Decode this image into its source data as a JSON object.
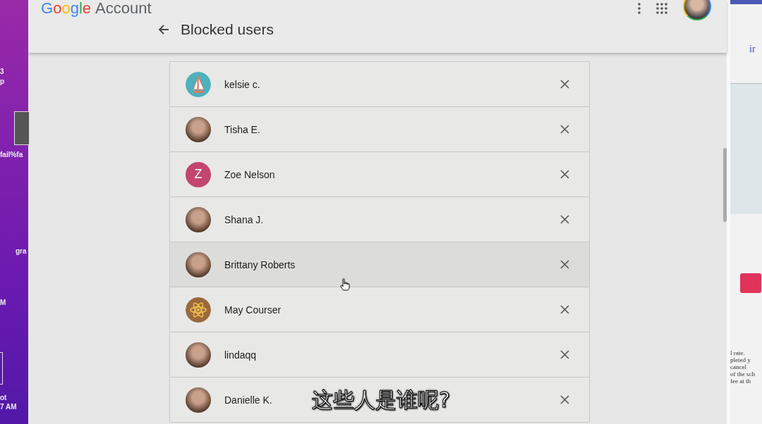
{
  "desktop_labels": [
    "3",
    "p",
    "fail%fa",
    "gra",
    "M",
    "ot",
    "7 AM"
  ],
  "header": {
    "logo": "Google",
    "product": "Account",
    "title": "Blocked users"
  },
  "rows": [
    {
      "name": "kelsie c.",
      "kind": "sailboat",
      "hovered": false
    },
    {
      "name": "Tisha E.",
      "kind": "photo",
      "hovered": false
    },
    {
      "name": "Zoe Nelson",
      "kind": "letter",
      "letter": "Z",
      "color": "#c2466f",
      "hovered": false
    },
    {
      "name": "Shana J.",
      "kind": "photo",
      "hovered": false
    },
    {
      "name": "Brittany Roberts",
      "kind": "photo",
      "hovered": true
    },
    {
      "name": "May Courser",
      "kind": "atom",
      "hovered": false
    },
    {
      "name": "lindaqq",
      "kind": "photo",
      "hovered": false
    },
    {
      "name": "Danielle K.",
      "kind": "photo",
      "hovered": false
    }
  ],
  "side_page": {
    "link": "ir",
    "lines": [
      "l rate.",
      "pleted y",
      "cancel",
      "of the sch",
      "fee at th"
    ]
  },
  "subtitle": "这些人是谁呢?"
}
